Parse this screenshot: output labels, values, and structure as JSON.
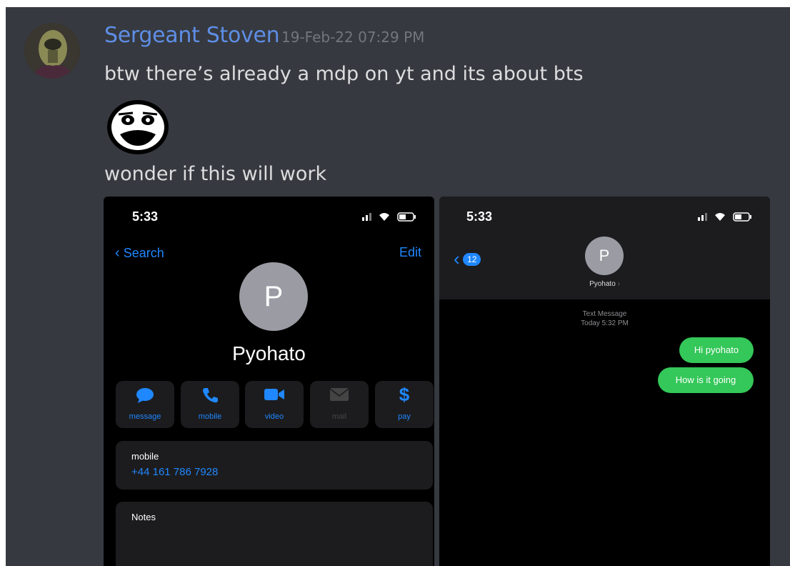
{
  "message": {
    "author": "Sergeant Stoven",
    "timestamp": "19-Feb-22 07:29 PM",
    "line1": "btw there’s already a mdp on yt and its about bts",
    "line2": "wonder if this will work"
  },
  "contact_screen": {
    "time": "5:33",
    "back_label": "Search",
    "edit_label": "Edit",
    "avatar_letter": "P",
    "name": "Pyohato",
    "actions": [
      {
        "label": "message",
        "icon": "message-bubble-icon"
      },
      {
        "label": "mobile",
        "icon": "phone-icon"
      },
      {
        "label": "video",
        "icon": "video-camera-icon"
      },
      {
        "label": "mail",
        "icon": "mail-icon"
      },
      {
        "label": "pay",
        "icon": "dollar-icon"
      }
    ],
    "phone_label": "mobile",
    "phone_number": "+44 161 786 7928",
    "notes_label": "Notes"
  },
  "messages_screen": {
    "time": "5:33",
    "back_badge": "12",
    "avatar_letter": "P",
    "contact_name": "Pyohato",
    "meta_line1": "Text Message",
    "meta_line2": "Today 5:32 PM",
    "bubbles": [
      "Hi pyohato",
      "How is it going"
    ]
  }
}
